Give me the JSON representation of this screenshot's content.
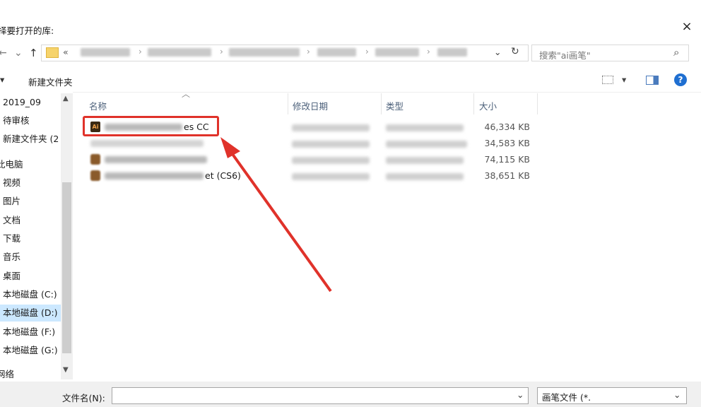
{
  "dialog": {
    "title": "择要打开的库:",
    "close": "×"
  },
  "nav": {
    "back": "←",
    "forward": "→",
    "recent": "⌄",
    "up": "↑",
    "more": "«",
    "dropdown": "⌄",
    "refresh": "↻"
  },
  "search": {
    "placeholder": "搜索\"ai画笔\"",
    "icon": "⌕"
  },
  "toolbar": {
    "organize": "▾",
    "new_folder": "新建文件夹",
    "view_arrow": "▾",
    "help": "?"
  },
  "sidebar": {
    "items": [
      "2019_09",
      "待审核",
      "新建文件夹 (2",
      "此电脑",
      "视频",
      "图片",
      "文档",
      "下载",
      "音乐",
      "桌面",
      "本地磁盘 (C:)",
      "本地磁盘 (D:)",
      "本地磁盘 (F:)",
      "本地磁盘 (G:)",
      "网络"
    ],
    "selected_index": 11
  },
  "columns": {
    "name": "名称",
    "date": "修改日期",
    "type": "类型",
    "size": "大小"
  },
  "files": [
    {
      "name_visible": "es CC",
      "size": "46,334 KB"
    },
    {
      "name_visible": "",
      "size": "34,583 KB"
    },
    {
      "name_visible": "",
      "size": "74,115 KB"
    },
    {
      "name_visible": "et (CS6)",
      "size": "38,651 KB"
    }
  ],
  "bottom": {
    "filename_label": "文件名(N):",
    "filename_value": "",
    "filetype": "画笔文件 (*.",
    "dropdown": "⌄"
  },
  "colors": {
    "highlight": "#e0322a",
    "selected_side": "#cce8ff",
    "help": "#1f6fd1"
  }
}
